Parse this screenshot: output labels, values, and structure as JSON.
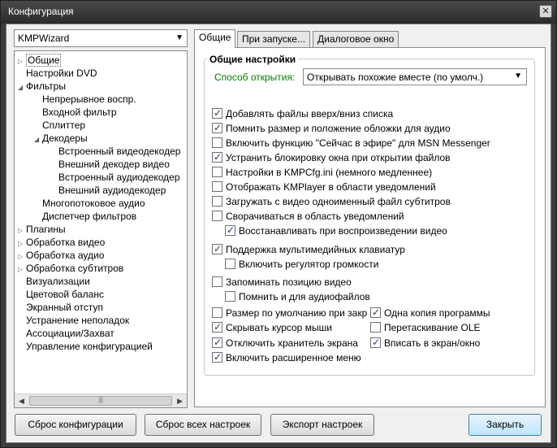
{
  "window": {
    "title": "Конфигурация"
  },
  "profile": {
    "selected": "KMPWizard"
  },
  "tree": {
    "items": [
      {
        "label": "Общие",
        "indent": 0,
        "exp": "▷",
        "sel": true
      },
      {
        "label": "Настройки DVD",
        "indent": 0,
        "exp": ""
      },
      {
        "label": "Фильтры",
        "indent": 0,
        "exp": "◢"
      },
      {
        "label": "Непрерывное воспр.",
        "indent": 1,
        "exp": ""
      },
      {
        "label": "Входной фильтр",
        "indent": 1,
        "exp": ""
      },
      {
        "label": "Сплиттер",
        "indent": 1,
        "exp": ""
      },
      {
        "label": "Декодеры",
        "indent": 1,
        "exp": "◢"
      },
      {
        "label": "Встроенный видеодекодер",
        "indent": 2,
        "exp": ""
      },
      {
        "label": "Внешний декодер видео",
        "indent": 2,
        "exp": ""
      },
      {
        "label": "Встроенный аудиодекодер",
        "indent": 2,
        "exp": ""
      },
      {
        "label": "Внешний аудиодекодер",
        "indent": 2,
        "exp": ""
      },
      {
        "label": "Многопотоковое аудио",
        "indent": 1,
        "exp": ""
      },
      {
        "label": "Диспетчер фильтров",
        "indent": 1,
        "exp": ""
      },
      {
        "label": "Плагины",
        "indent": 0,
        "exp": "▷"
      },
      {
        "label": "Обработка видео",
        "indent": 0,
        "exp": "▷"
      },
      {
        "label": "Обработка аудио",
        "indent": 0,
        "exp": "▷"
      },
      {
        "label": "Обработка субтитров",
        "indent": 0,
        "exp": "▷"
      },
      {
        "label": "Визуализации",
        "indent": 0,
        "exp": ""
      },
      {
        "label": "Цветовой баланс",
        "indent": 0,
        "exp": ""
      },
      {
        "label": "Экранный отступ",
        "indent": 0,
        "exp": ""
      },
      {
        "label": "Устранение неполадок",
        "indent": 0,
        "exp": ""
      },
      {
        "label": "Ассоциации/Захват",
        "indent": 0,
        "exp": ""
      },
      {
        "label": "Управление конфигурацией",
        "indent": 0,
        "exp": ""
      }
    ]
  },
  "tabs": [
    {
      "label": "Общие",
      "active": true
    },
    {
      "label": "При запуске...",
      "active": false
    },
    {
      "label": "Диалоговое окно",
      "active": false
    }
  ],
  "general": {
    "group_title": "Общие настройки",
    "open_label": "Способ открытия:",
    "open_value": "Открывать похожие вместе (по умолч.)",
    "options": [
      {
        "label": "Добавлять файлы вверх/вниз списка",
        "checked": true
      },
      {
        "label": "Помнить размер и положение обложки для аудио",
        "checked": true
      },
      {
        "label": "Включить функцию \"Сейчас в эфире\" для MSN Messenger",
        "checked": false
      },
      {
        "label": "Устранить блокировку окна при открытии файлов",
        "checked": true
      },
      {
        "label": "Настройки в KMPCfg.ini (немного медленнее)",
        "checked": false
      },
      {
        "label": "Отображать KMPlayer в области уведомлений",
        "checked": false
      },
      {
        "label": "Загружать с видео одноименный файл субтитров",
        "checked": false
      },
      {
        "label": "Сворачиваться в область уведомлений",
        "checked": false
      },
      {
        "label": "Восстанавливать при воспроизведении видео",
        "checked": true
      },
      {
        "label": "Поддержка мультимедийных клавиатур",
        "checked": true
      },
      {
        "label": "Включить регулятор громкости",
        "checked": false
      },
      {
        "label": "Запоминать позицию видео",
        "checked": false
      },
      {
        "label": "Помнить и для аудиофайлов",
        "checked": false
      },
      {
        "label": "Размер по умолчанию при закр",
        "checked": false
      },
      {
        "label": "Одна копия программы",
        "checked": true
      },
      {
        "label": "Скрывать курсор мыши",
        "checked": true
      },
      {
        "label": "Перетаскивание OLE",
        "checked": false
      },
      {
        "label": "Отключить хранитель экрана",
        "checked": true
      },
      {
        "label": "Вписать в экран/окно",
        "checked": true
      },
      {
        "label": "Включить расширенное меню",
        "checked": true
      }
    ]
  },
  "buttons": {
    "reset_config": "Сброс конфигурации",
    "reset_all": "Сброс всех настроек",
    "export": "Экспорт настроек",
    "close": "Закрыть"
  }
}
